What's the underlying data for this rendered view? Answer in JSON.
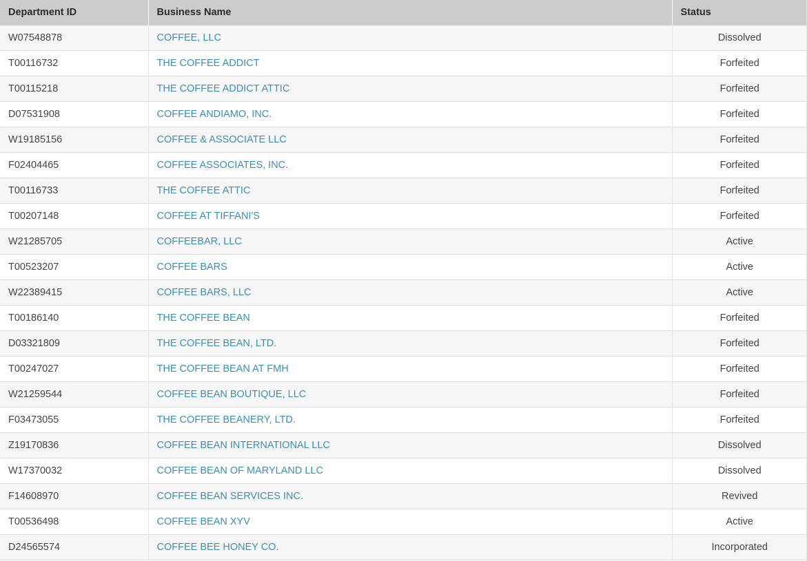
{
  "table": {
    "columns": [
      {
        "key": "department_id",
        "label": "Department ID",
        "align": "left"
      },
      {
        "key": "business_name",
        "label": "Business Name",
        "align": "left"
      },
      {
        "key": "status",
        "label": "Status",
        "align": "center"
      }
    ],
    "header_background": "#cccccc",
    "link_color": "#3b8fb5",
    "row_alt_background": "#f7f7f7",
    "rows": [
      {
        "department_id": "W07548878",
        "business_name": "COFFEE, LLC",
        "status": "Dissolved"
      },
      {
        "department_id": "T00116732",
        "business_name": "THE COFFEE ADDICT",
        "status": "Forfeited"
      },
      {
        "department_id": "T00115218",
        "business_name": "THE COFFEE ADDICT ATTIC",
        "status": "Forfeited"
      },
      {
        "department_id": "D07531908",
        "business_name": "COFFEE ANDIAMO, INC.",
        "status": "Forfeited"
      },
      {
        "department_id": "W19185156",
        "business_name": "COFFEE & ASSOCIATE LLC",
        "status": "Forfeited"
      },
      {
        "department_id": "F02404465",
        "business_name": "COFFEE ASSOCIATES, INC.",
        "status": "Forfeited"
      },
      {
        "department_id": "T00116733",
        "business_name": "THE COFFEE ATTIC",
        "status": "Forfeited"
      },
      {
        "department_id": "T00207148",
        "business_name": "COFFEE AT TIFFANI'S",
        "status": "Forfeited"
      },
      {
        "department_id": "W21285705",
        "business_name": "COFFEEBAR, LLC",
        "status": "Active"
      },
      {
        "department_id": "T00523207",
        "business_name": "COFFEE BARS",
        "status": "Active"
      },
      {
        "department_id": "W22389415",
        "business_name": "COFFEE BARS, LLC",
        "status": "Active"
      },
      {
        "department_id": "T00186140",
        "business_name": "THE COFFEE BEAN",
        "status": "Forfeited"
      },
      {
        "department_id": "D03321809",
        "business_name": "THE COFFEE BEAN, LTD.",
        "status": "Forfeited"
      },
      {
        "department_id": "T00247027",
        "business_name": "THE COFFEE BEAN AT FMH",
        "status": "Forfeited"
      },
      {
        "department_id": "W21259544",
        "business_name": "COFFEE BEAN BOUTIQUE, LLC",
        "status": "Forfeited"
      },
      {
        "department_id": "F03473055",
        "business_name": "THE COFFEE BEANERY, LTD.",
        "status": "Forfeited"
      },
      {
        "department_id": "Z19170836",
        "business_name": "COFFEE BEAN INTERNATIONAL LLC",
        "status": "Dissolved"
      },
      {
        "department_id": "W17370032",
        "business_name": "COFFEE BEAN OF MARYLAND LLC",
        "status": "Dissolved"
      },
      {
        "department_id": "F14608970",
        "business_name": "COFFEE BEAN SERVICES INC.",
        "status": "Revived"
      },
      {
        "department_id": "T00536498",
        "business_name": "COFFEE BEAN XYV",
        "status": "Active"
      },
      {
        "department_id": "D24565574",
        "business_name": "COFFEE BEE HONEY CO.",
        "status": "Incorporated"
      }
    ]
  }
}
